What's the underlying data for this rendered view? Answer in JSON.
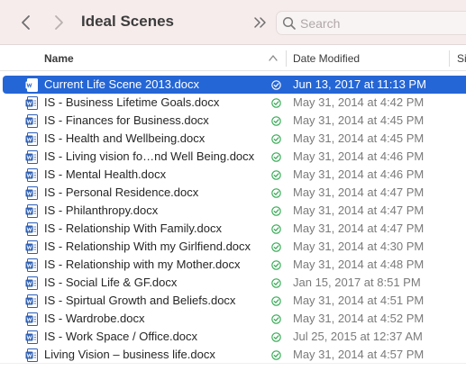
{
  "window": {
    "title": "Ideal Scenes",
    "back_icon": "chevron-left-icon",
    "forward_icon": "chevron-right-icon",
    "more_icon": "double-chevron-right-icon"
  },
  "search": {
    "placeholder": "Search",
    "value": ""
  },
  "columns": {
    "name": "Name",
    "date": "Date Modified",
    "size": "Si"
  },
  "colors": {
    "selection": "#2566d6",
    "sync_check": "#2fa84f",
    "doc_icon": "#2f5fb3"
  },
  "files": [
    {
      "name": "Current Life Scene 2013.docx",
      "date": "Jun 13, 2017 at 11:13 PM",
      "selected": true
    },
    {
      "name": "IS - Business Lifetime Goals.docx",
      "date": "May 31, 2014 at 4:42 PM"
    },
    {
      "name": "IS - Finances for Business.docx",
      "date": "May 31, 2014 at 4:45 PM"
    },
    {
      "name": "IS - Health and Wellbeing.docx",
      "date": "May 31, 2014 at 4:45 PM"
    },
    {
      "name": "IS - Living vision fo…nd Well Being.docx",
      "date": "May 31, 2014 at 4:46 PM"
    },
    {
      "name": "IS - Mental Health.docx",
      "date": "May 31, 2014 at 4:46 PM"
    },
    {
      "name": "IS - Personal Residence.docx",
      "date": "May 31, 2014 at 4:47 PM"
    },
    {
      "name": "IS - Philanthropy.docx",
      "date": "May 31, 2014 at 4:47 PM"
    },
    {
      "name": "IS - Relationship With Family.docx",
      "date": "May 31, 2014 at 4:47 PM"
    },
    {
      "name": "IS - Relationship With my Girlfiend.docx",
      "date": "May 31, 2014 at 4:30 PM"
    },
    {
      "name": "IS - Relationship with my Mother.docx",
      "date": "May 31, 2014 at 4:48 PM"
    },
    {
      "name": "IS - Social Life & GF.docx",
      "date": "Jan 15, 2017 at 8:51 PM"
    },
    {
      "name": "IS - Spirtual Growth and Beliefs.docx",
      "date": "May 31, 2014 at 4:51 PM"
    },
    {
      "name": "IS - Wardrobe.docx",
      "date": "May 31, 2014 at 4:52 PM"
    },
    {
      "name": "IS - Work Space / Office.docx",
      "date": "Jul 25, 2015 at 12:37 AM"
    },
    {
      "name": "Living Vision – business life.docx",
      "date": "May 31, 2014 at 4:57 PM"
    }
  ]
}
